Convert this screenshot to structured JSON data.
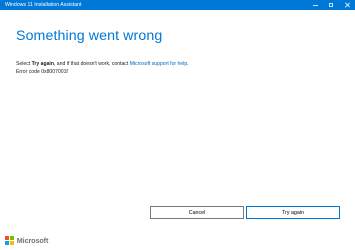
{
  "window": {
    "title": "Windows 11 Installation Assistant",
    "accent_color": "#0078d7"
  },
  "main": {
    "heading": "Something went wrong",
    "instruction_prefix": "Select ",
    "instruction_bold": "Try again",
    "instruction_middle": ", and if that doesn't work, contact ",
    "support_link": "Microsoft support for help",
    "instruction_suffix": ".",
    "error_code": "Error code 0x8007001f"
  },
  "buttons": {
    "cancel_label": "Cancel",
    "try_again_label": "Try again"
  },
  "footer": {
    "brand": "Microsoft",
    "logo_colors": [
      "#f25022",
      "#7fba00",
      "#00a4ef",
      "#ffb900"
    ]
  }
}
